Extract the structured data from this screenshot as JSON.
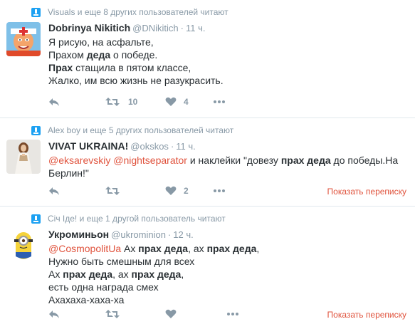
{
  "colors": {
    "link": "#e0533d",
    "muted": "#8899a6",
    "text": "#292f33",
    "divider": "#e1e8ed"
  },
  "tweets": [
    {
      "context": "Visuals и еще 8 других пользователей читают",
      "name": "Dobrinya Nikitich",
      "handle": "@DNikitich",
      "time": "11 ч.",
      "lines": [
        "Я рисую, на асфальте,",
        "Прахом ",
        "деда",
        " о победе.",
        "Прах",
        " стащила в пятом классе,",
        "Жалко, им всю жизнь не разукрасить."
      ],
      "retweets": "10",
      "likes": "4",
      "avatar_icon": "cartoon-man-avatar"
    },
    {
      "context": "Alex boy и еще 5 других пользователей читают",
      "name": "VIVAT UKRAINA!",
      "handle": "@okskos",
      "time": "11 ч.",
      "mention1": "@eksarevskiy",
      "mention2": "@nightseparator",
      "t1": " и наклейки \"довезу ",
      "t2": "прах деда",
      "t3": " до победы.На",
      "t4": "Берлин!\"",
      "retweets": "",
      "likes": "2",
      "convo": "Показать переписку",
      "avatar_icon": "woman-in-dress-avatar"
    },
    {
      "context": "Січ Ідe! и еще 1 другой пользователь читают",
      "name": "Укроминьон",
      "handle": "@ukrominion",
      "time": "12 ч.",
      "mention": "@CosmopolitUa",
      "l1a": " Ах ",
      "l1b": "прах деда",
      "l1c": ", ах ",
      "l1d": "прах деда",
      "l1e": ",",
      "l2": "Нужно быть смешным для всех",
      "l3a": "Ах ",
      "l3b": "прах деда",
      "l3c": ", ах ",
      "l3d": "прах деда",
      "l3e": ",",
      "l4": "есть одна награда смех",
      "l5": "Ахахаха-хаха-ха",
      "convo": "Показать переписку",
      "avatar_icon": "minion-avatar"
    }
  ]
}
